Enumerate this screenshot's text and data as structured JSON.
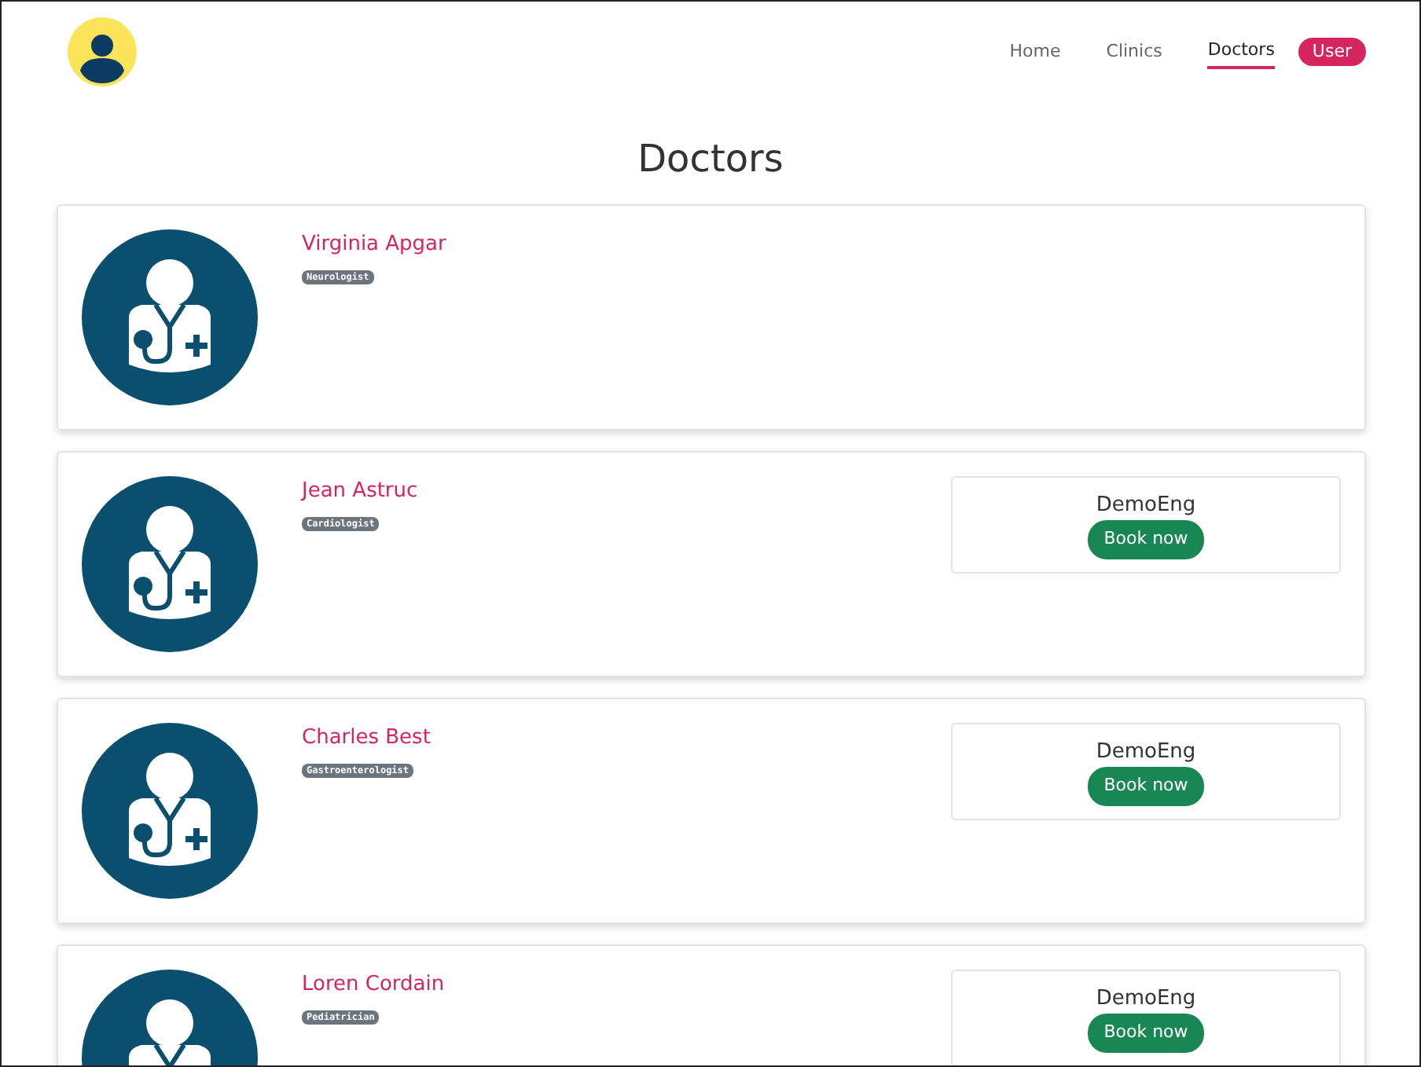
{
  "nav": [
    {
      "label": "Home",
      "kind": "link",
      "selected": false
    },
    {
      "label": "Clinics",
      "kind": "link",
      "selected": false
    },
    {
      "label": "Doctors",
      "kind": "link",
      "selected": true
    },
    {
      "label": "User",
      "kind": "pill",
      "selected": false
    }
  ],
  "page_title": "Doctors",
  "doctors": [
    {
      "name": "Virginia Apgar",
      "specialty": "Neurologist"
    },
    {
      "name": "Jean Astruc",
      "specialty": "Cardiologist",
      "clinics": [
        {
          "name": "DemoEng",
          "button": "Book now"
        }
      ]
    },
    {
      "name": "Charles Best",
      "specialty": "Gastroenterologist",
      "clinics": [
        {
          "name": "DemoEng",
          "button": "Book now"
        }
      ]
    },
    {
      "name": "Loren Cordain",
      "specialty": "Pediatrician",
      "clinics": [
        {
          "name": "DemoEng",
          "button": "Book now"
        }
      ]
    }
  ]
}
